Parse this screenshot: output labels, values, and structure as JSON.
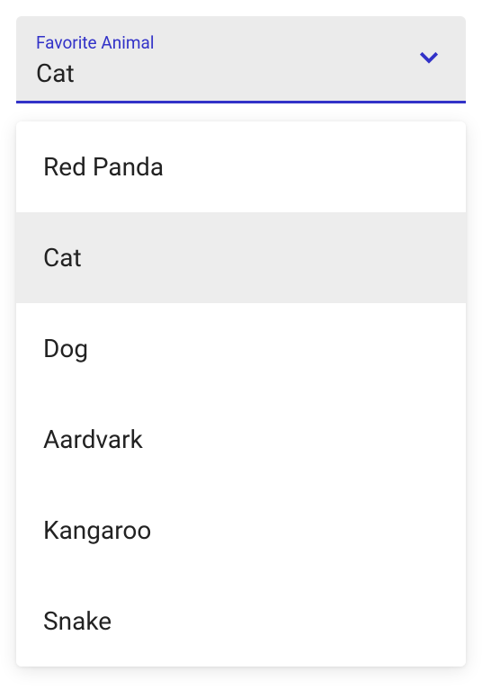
{
  "select": {
    "label": "Favorite Animal",
    "value": "Cat",
    "options": [
      {
        "label": "Red Panda",
        "selected": false
      },
      {
        "label": "Cat",
        "selected": true
      },
      {
        "label": "Dog",
        "selected": false
      },
      {
        "label": "Aardvark",
        "selected": false
      },
      {
        "label": "Kangaroo",
        "selected": false
      },
      {
        "label": "Snake",
        "selected": false
      }
    ]
  }
}
